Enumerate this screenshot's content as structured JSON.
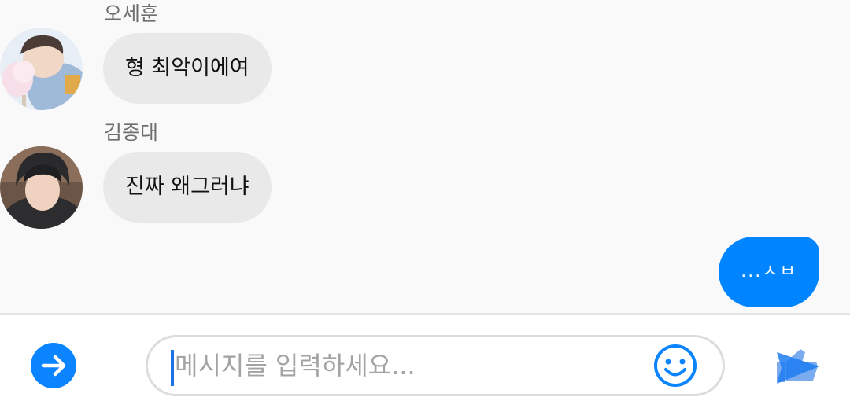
{
  "messages": [
    {
      "sender": "오세훈",
      "text": "형 최악이에여"
    },
    {
      "sender": "김종대",
      "text": "진짜 왜그러냐"
    }
  ],
  "outgoing": {
    "text": "...ㅅㅂ"
  },
  "composer": {
    "placeholder": "메시지를 입력하세요...",
    "expand_icon": "arrow-right-icon",
    "emoji_icon": "smiley-icon",
    "send_icon": "send-like-icon"
  },
  "colors": {
    "accent": "#0084ff",
    "incoming_bubble": "#e9e9e9",
    "background": "#f9f9f9"
  }
}
